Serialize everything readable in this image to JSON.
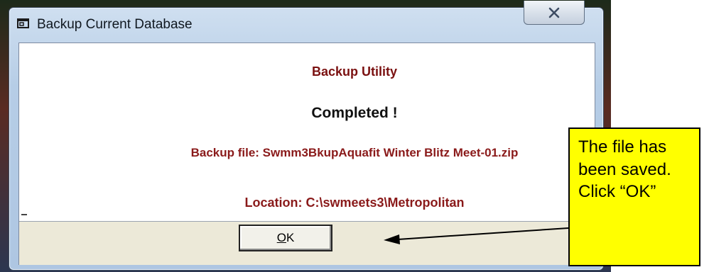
{
  "window": {
    "title": "Backup Current Database",
    "icon": "window-icon",
    "close_icon": "close-x-icon"
  },
  "dialog": {
    "heading": "Backup Utility",
    "status": "Completed !",
    "backup_file": "Backup file: Swmm3BkupAquafit Winter Blitz Meet-01.zip",
    "location": "Location: C:\\swmeets3\\Metropolitan",
    "ok_button": {
      "mnemonic": "O",
      "rest": "K"
    }
  },
  "callout": {
    "text": "The file has been saved. Click “OK”"
  },
  "colors": {
    "heading": "#7a1010",
    "detail_text": "#8a1a1a",
    "callout_bg": "#ffff00"
  }
}
